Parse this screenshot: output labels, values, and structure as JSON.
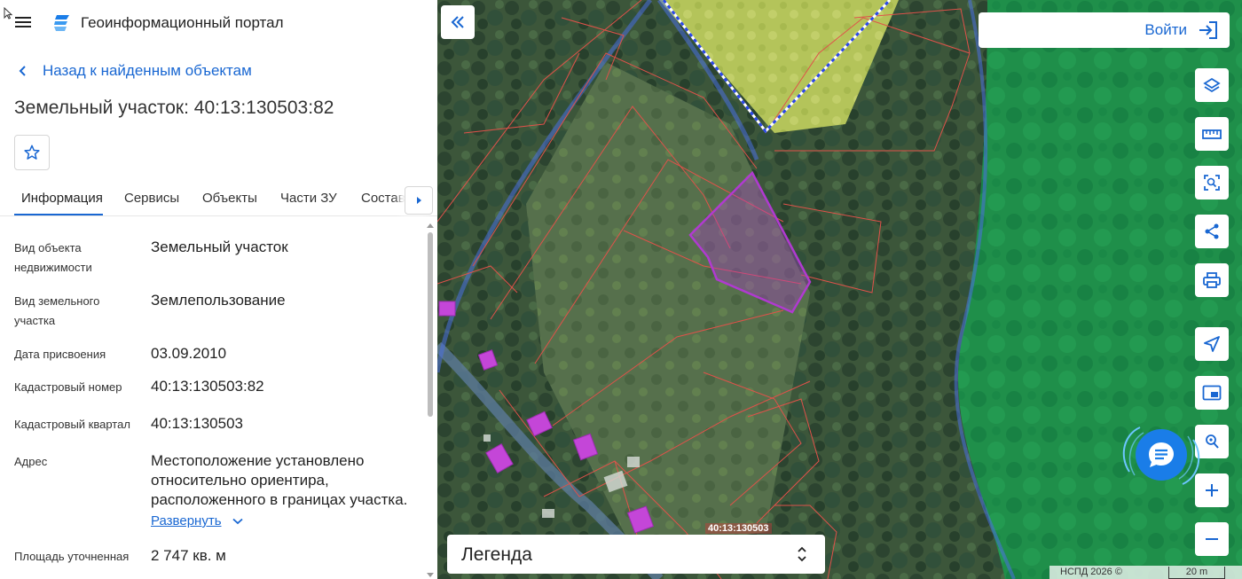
{
  "app": {
    "title": "Геоинформационный портал"
  },
  "nav": {
    "back_label": "Назад к найденным объектам"
  },
  "object": {
    "title": "Земельный участок: 40:13:130503:82"
  },
  "tabs": [
    {
      "label": "Информация",
      "active": true
    },
    {
      "label": "Сервисы"
    },
    {
      "label": "Объекты"
    },
    {
      "label": "Части ЗУ"
    },
    {
      "label": "Состав"
    }
  ],
  "properties": [
    {
      "label": "Вид объекта недвижимости",
      "value": "Земельный участок"
    },
    {
      "label": "Вид земельного участка",
      "value": "Землепользование"
    },
    {
      "label": "Дата присвоения",
      "value": "03.09.2010"
    },
    {
      "label": "Кадастровый номер",
      "value": "40:13:130503:82"
    },
    {
      "label": "Кадастровый квартал",
      "value": "40:13:130503"
    },
    {
      "label": "Адрес",
      "value": "Местоположение установлено относительно ориентира, расположенного в границах участка."
    },
    {
      "label": "Площадь уточненная",
      "value": "2 747 кв. м"
    }
  ],
  "expand_label": "Развернуть",
  "map": {
    "login_label": "Войти",
    "legend_label": "Легенда",
    "quarter_label": "40:13:130503",
    "attribution": "НСПД 2026 ©",
    "scale_label": "20 m"
  },
  "colors": {
    "accent": "#1967d2",
    "chat_button": "#1a7de8",
    "parcel_highlight": "#b03ad0",
    "parcel_border": "#e0524a",
    "forest_zone": "#1f8f4a"
  },
  "icons": {
    "menu": "hamburger-icon",
    "layers": "layers-icon",
    "ruler": "ruler-icon",
    "select": "area-select-icon",
    "share": "share-icon",
    "print": "print-icon",
    "locate": "navigation-arrow-icon",
    "picture": "picture-in-picture-icon",
    "search_point": "map-search-icon",
    "zoom_in": "plus-icon",
    "zoom_out": "minus-icon"
  }
}
